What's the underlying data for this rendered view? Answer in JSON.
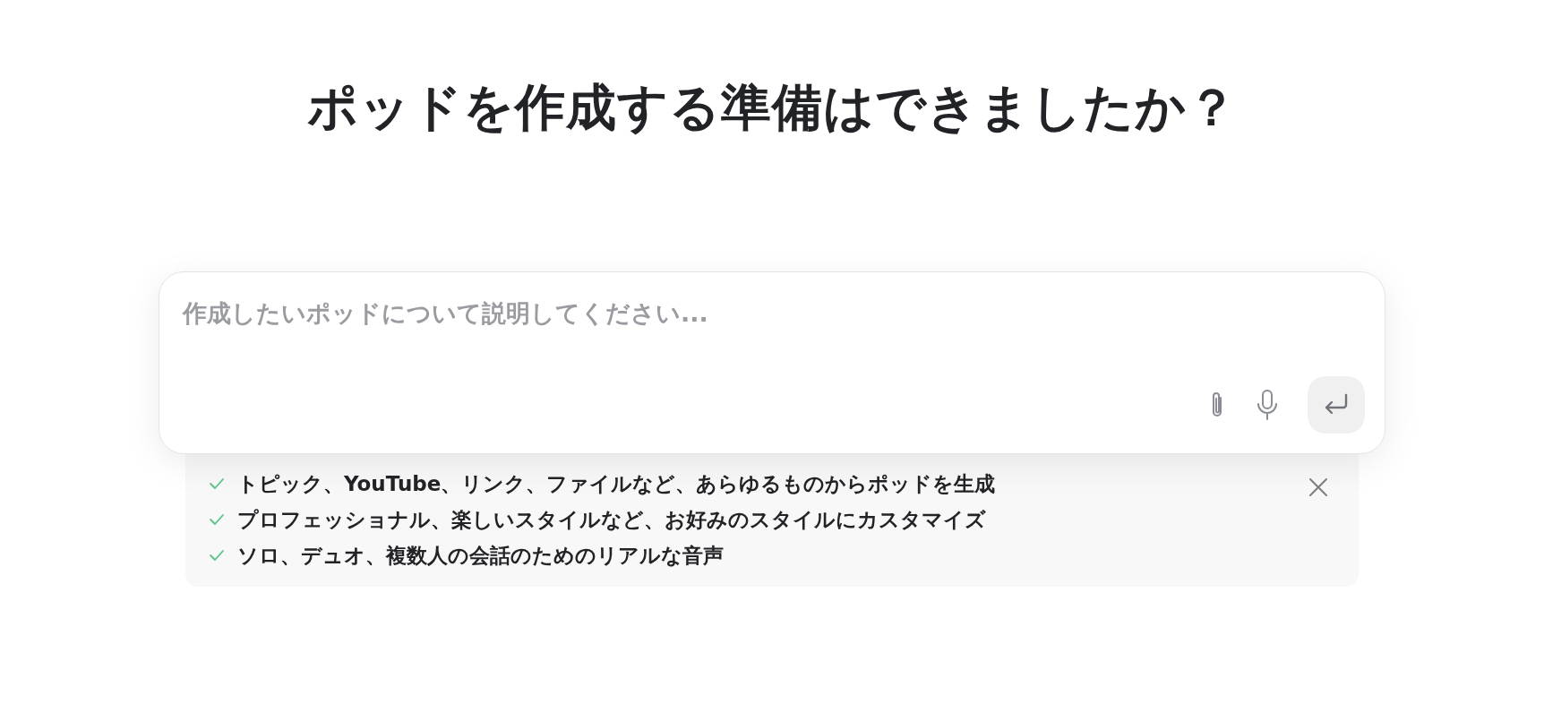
{
  "heading": "ポッドを作成する準備はできましたか？",
  "prompt": {
    "placeholder": "作成したいポッドについて説明してください..."
  },
  "tips": [
    "トピック、YouTube、リンク、ファイルなど、あらゆるものからポッドを生成",
    "プロフェッショナル、楽しいスタイルなど、お好みのスタイルにカスタマイズ",
    "ソロ、デュオ、複数人の会話のためのリアルな音声"
  ]
}
